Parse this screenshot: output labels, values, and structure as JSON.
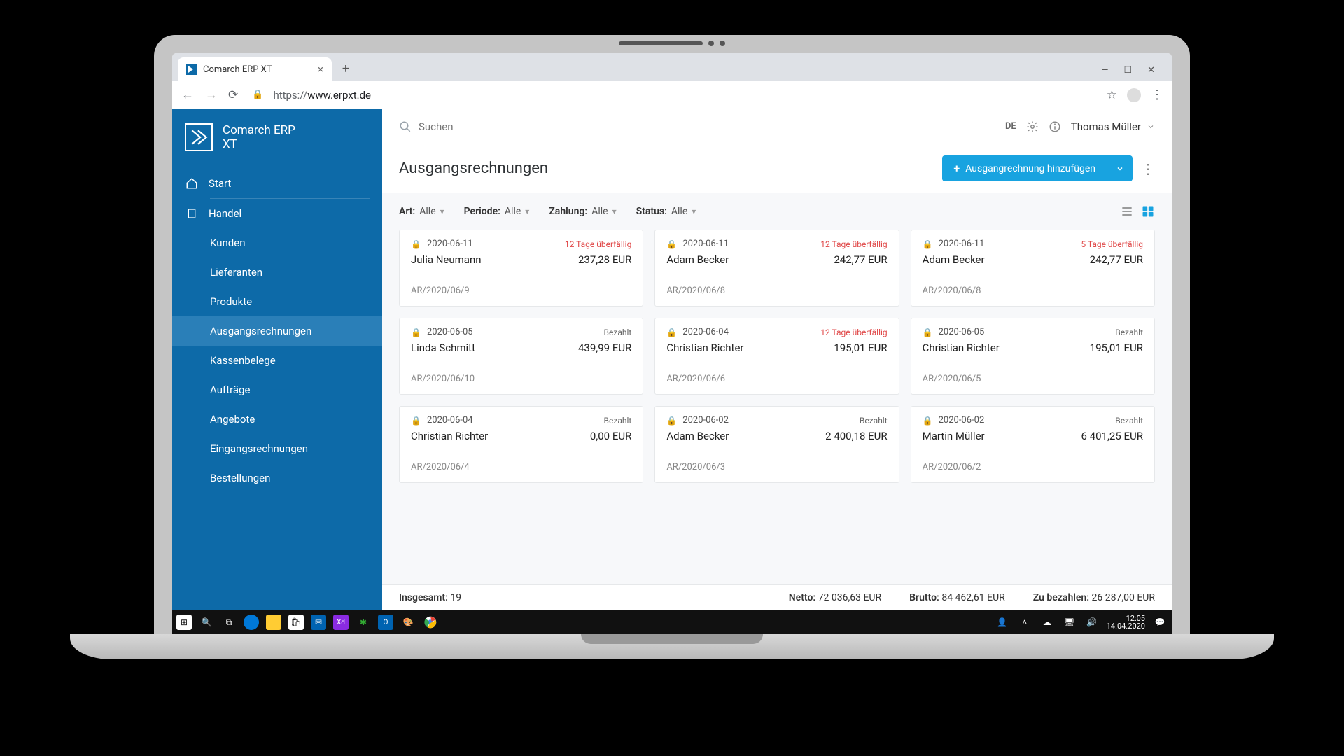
{
  "browser": {
    "tab_title": "Comarch ERP XT",
    "url_prefix": "https://",
    "url_domain": "www.erpxt.de"
  },
  "sidebar": {
    "brand_line1": "Comarch ERP",
    "brand_line2": "XT",
    "start": "Start",
    "handel": "Handel",
    "items": [
      "Kunden",
      "Lieferanten",
      "Produkte",
      "Ausgangsrechnungen",
      "Kassenbelege",
      "Aufträge",
      "Angebote",
      "Eingangsrechnungen",
      "Bestellungen"
    ]
  },
  "topbar": {
    "search_placeholder": "Suchen",
    "language": "DE",
    "user": "Thomas Müller"
  },
  "page": {
    "title": "Ausgangsrechnungen",
    "add_button": "Ausgangrechnung hinzufügen"
  },
  "filters": {
    "art_label": "Art:",
    "art_value": "Alle",
    "periode_label": "Periode:",
    "periode_value": "Alle",
    "zahlung_label": "Zahlung:",
    "zahlung_value": "Alle",
    "status_label": "Status:",
    "status_value": "Alle"
  },
  "cards": [
    {
      "date": "2020-06-11",
      "status_text": "12 Tage überfällig",
      "status_type": "overdue",
      "name": "Julia Neumann",
      "amount": "237,28 EUR",
      "ref": "AR/2020/06/9"
    },
    {
      "date": "2020-06-11",
      "status_text": "12 Tage überfällig",
      "status_type": "overdue",
      "name": "Adam Becker",
      "amount": "242,77 EUR",
      "ref": "AR/2020/06/8"
    },
    {
      "date": "2020-06-11",
      "status_text": "5 Tage überfällig",
      "status_type": "overdue",
      "name": "Adam Becker",
      "amount": "242,77 EUR",
      "ref": "AR/2020/06/8"
    },
    {
      "date": "2020-06-05",
      "status_text": "Bezahlt",
      "status_type": "paid",
      "name": "Linda Schmitt",
      "amount": "439,99 EUR",
      "ref": "AR/2020/06/10"
    },
    {
      "date": "2020-06-04",
      "status_text": "12 Tage überfällig",
      "status_type": "overdue",
      "name": "Christian Richter",
      "amount": "195,01 EUR",
      "ref": "AR/2020/06/6"
    },
    {
      "date": "2020-06-05",
      "status_text": "Bezahlt",
      "status_type": "paid",
      "name": "Christian Richter",
      "amount": "195,01 EUR",
      "ref": "AR/2020/06/5"
    },
    {
      "date": "2020-06-04",
      "status_text": "Bezahlt",
      "status_type": "paid",
      "name": "Christian Richter",
      "amount": "0,00 EUR",
      "ref": "AR/2020/06/4"
    },
    {
      "date": "2020-06-02",
      "status_text": "Bezahlt",
      "status_type": "paid",
      "name": "Adam Becker",
      "amount": "2 400,18 EUR",
      "ref": "AR/2020/06/3"
    },
    {
      "date": "2020-06-02",
      "status_text": "Bezahlt",
      "status_type": "paid",
      "name": "Martin Müller",
      "amount": "6 401,25 EUR",
      "ref": "AR/2020/06/2"
    }
  ],
  "summary": {
    "total_label": "Insgesamt:",
    "total_value": "19",
    "netto_label": "Netto:",
    "netto_value": "72 036,63 EUR",
    "brutto_label": "Brutto:",
    "brutto_value": "84 462,61 EUR",
    "due_label": "Zu bezahlen:",
    "due_value": "26 287,00 EUR"
  },
  "taskbar": {
    "time": "12:05",
    "date": "14.04.2020"
  }
}
